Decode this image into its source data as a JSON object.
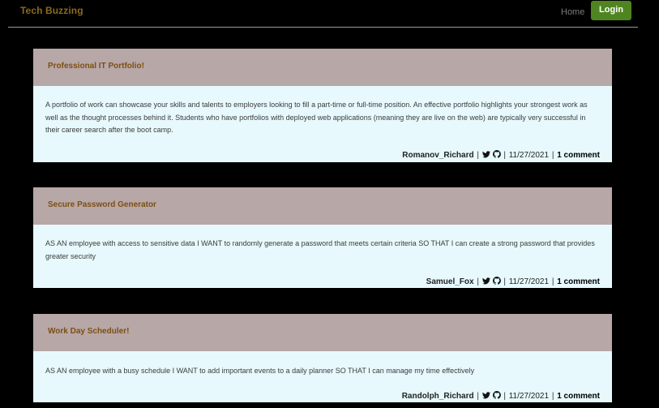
{
  "header": {
    "brand": "Tech Buzzing",
    "nav_home": "Home",
    "login_label": "Login"
  },
  "posts": [
    {
      "title": "Professional IT Portfolio!",
      "body": "A portfolio of work can showcase your skills and talents to employers looking to fill a part-time or full-time position. An effective portfolio highlights your strongest work as well as the thought processes behind it. Students who have portfolios with deployed web applications (meaning they are live on the web) are typically very successful in their career search after the boot camp.",
      "author": "Romanov_Richard",
      "date": "11/27/2021",
      "comments": "1 comment",
      "icons": [
        "twitter-icon",
        "github-icon"
      ]
    },
    {
      "title": "Secure Password Generator",
      "body": "AS AN employee with access to sensitive data I WANT to randomly generate a password that meets certain criteria SO THAT I can create a strong password that provides greater security",
      "author": "Samuel_Fox",
      "date": "11/27/2021",
      "comments": "1 comment",
      "icons": [
        "twitter-icon",
        "github-icon"
      ]
    },
    {
      "title": "Work Day Scheduler!",
      "body": "AS AN employee with a busy schedule I WANT to add important events to a daily planner SO THAT I can manage my time effectively",
      "author": "Randolph_Richard",
      "date": "11/27/2021",
      "comments": "1 comment",
      "icons": [
        "twitter-icon",
        "github-icon"
      ]
    }
  ],
  "colors": {
    "background": "#000000",
    "brand": "#8a6a1e",
    "login_button": "#4e8520",
    "title_bar": "#b8a7a7",
    "title_text": "#7a4f14",
    "card": "#e7f9fc"
  }
}
